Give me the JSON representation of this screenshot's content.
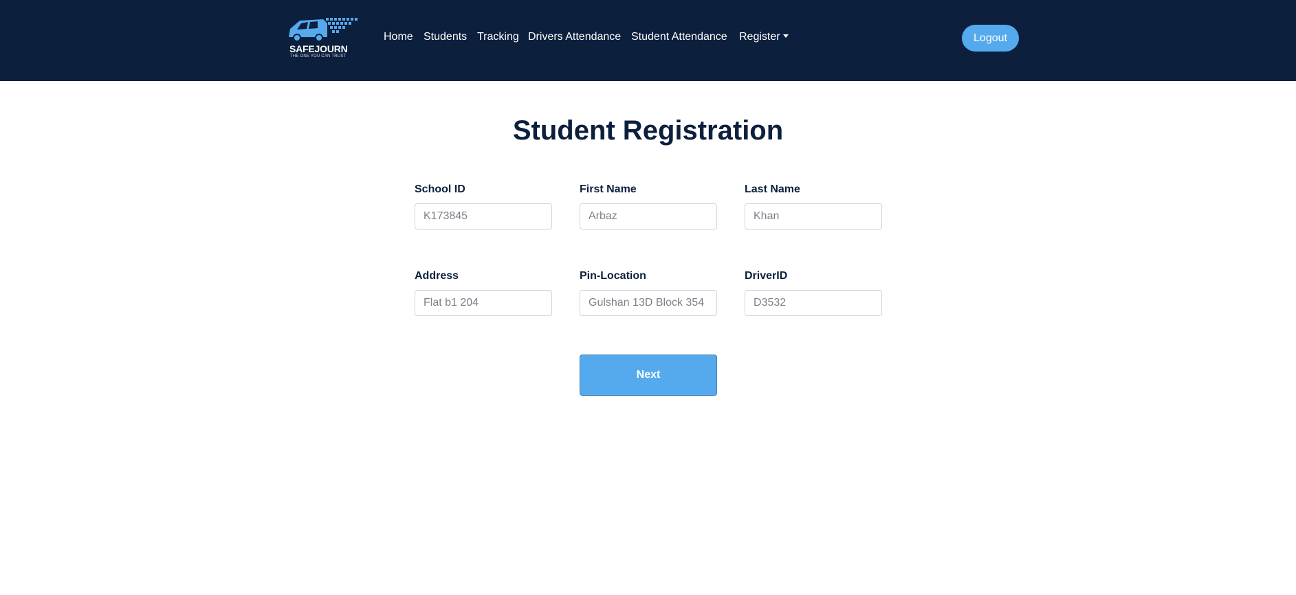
{
  "brand": {
    "name": "SAFEJOURN",
    "tagline": "THE ONE YOU CAN TRUST",
    "logo_icon": "van-icon"
  },
  "nav": {
    "links": [
      "Home",
      "Students",
      "Tracking",
      "Drivers Attendance",
      "Student Attendance",
      "Register"
    ],
    "logout_label": "Logout"
  },
  "colors": {
    "navbar": "#0c1f3d",
    "accent": "#55aaed",
    "heading": "#0c1f3d"
  },
  "page": {
    "title": "Student Registration"
  },
  "form": {
    "school_id": {
      "label": "School ID",
      "placeholder": "K173845"
    },
    "first_name": {
      "label": "First Name",
      "placeholder": "Arbaz"
    },
    "last_name": {
      "label": "Last Name",
      "placeholder": "Khan"
    },
    "address": {
      "label": "Address",
      "placeholder": "Flat b1 204"
    },
    "pin_location": {
      "label": "Pin-Location",
      "placeholder": "Gulshan 13D Block 354"
    },
    "driver_id": {
      "label": "DriverID",
      "placeholder": "D3532"
    },
    "next_label": "Next"
  }
}
